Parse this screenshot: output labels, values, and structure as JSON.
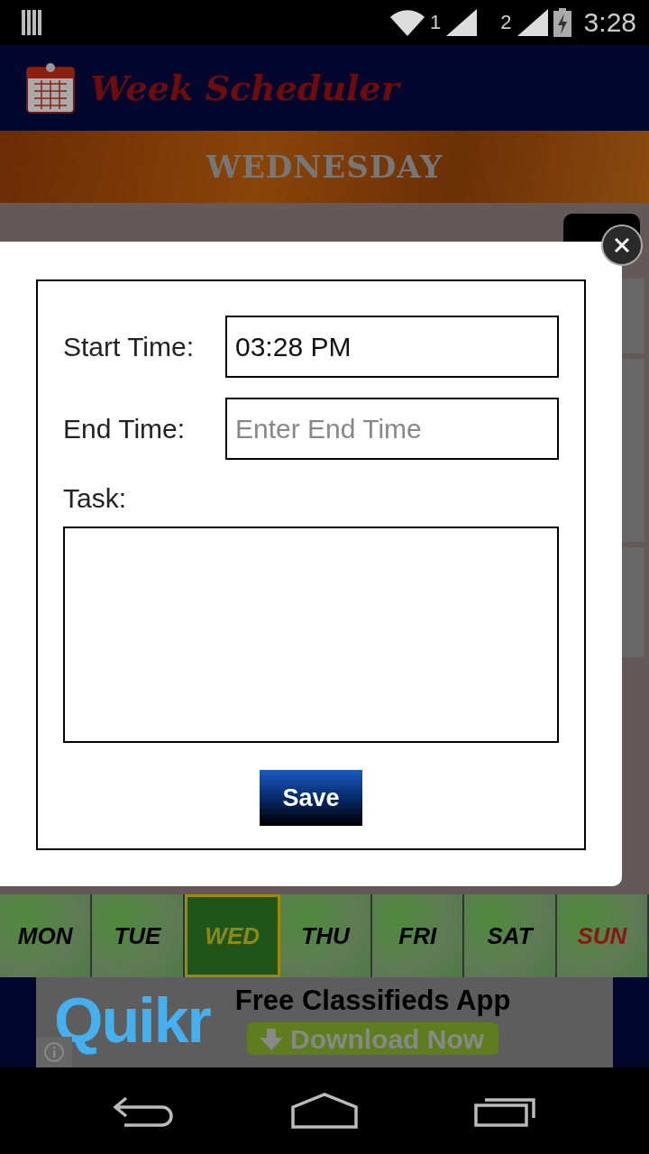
{
  "status_bar": {
    "sim1": "1",
    "sim2": "2",
    "time": "3:28"
  },
  "header": {
    "title": "Week Scheduler"
  },
  "day_title": "WEDNESDAY",
  "dialog": {
    "fields": [
      {
        "label": "Start Time:",
        "value": "03:28 PM"
      },
      {
        "label": "End Time:",
        "placeholder": "Enter End Time"
      }
    ],
    "task_label": "Task:",
    "save_button": "Save"
  },
  "days": [
    {
      "label": "MON",
      "selected": false,
      "holiday": false
    },
    {
      "label": "TUE",
      "selected": false,
      "holiday": false
    },
    {
      "label": "WED",
      "selected": true,
      "holiday": false
    },
    {
      "label": "THU",
      "selected": false,
      "holiday": false
    },
    {
      "label": "FRI",
      "selected": false,
      "holiday": false
    },
    {
      "label": "SAT",
      "selected": false,
      "holiday": false
    },
    {
      "label": "SUN",
      "selected": false,
      "holiday": true
    }
  ],
  "ad": {
    "logo": "Quikr",
    "headline": "Free Classifieds App",
    "button": "Download Now"
  }
}
